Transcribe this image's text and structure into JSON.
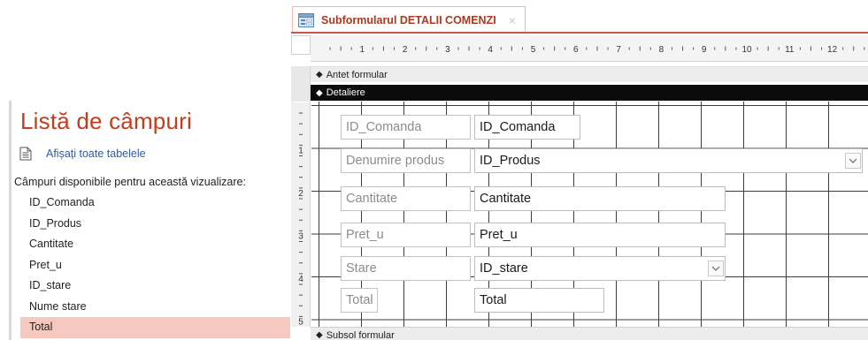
{
  "field_list": {
    "title": "Listă de câmpuri",
    "show_all_tables": "Afișați toate tabelele",
    "available_label": "Câmpuri disponibile pentru această vizualizare:",
    "fields": [
      "ID_Comanda",
      "ID_Produs",
      "Cantitate",
      "Pret_u",
      "ID_stare",
      "Nume stare",
      "Total"
    ],
    "selected_field": "Total"
  },
  "tab": {
    "title": "Subformularul DETALII COMENZI",
    "close_symbol": "×"
  },
  "ruler": {
    "h_numbers": [
      "1",
      "2",
      "3",
      "4",
      "5",
      "6",
      "7",
      "8",
      "9",
      "10",
      "11",
      "12"
    ],
    "v_numbers": [
      "1",
      "2",
      "3",
      "4",
      "5"
    ]
  },
  "sections": {
    "header": "Antet formular",
    "detail": "Detaliere",
    "footer": "Subsol formular"
  },
  "controls": [
    {
      "label": "ID_Comanda",
      "value": "ID_Comanda",
      "type": "text"
    },
    {
      "label": "Denumire produs",
      "value": "ID_Produs",
      "type": "combo"
    },
    {
      "label": "Cantitate",
      "value": "Cantitate",
      "type": "text"
    },
    {
      "label": "Pret_u",
      "value": "Pret_u",
      "type": "text"
    },
    {
      "label": "Stare",
      "value": "ID_stare",
      "type": "combo"
    },
    {
      "label": "Total",
      "value": "Total",
      "type": "text"
    }
  ],
  "colors": {
    "accent": "#c43b1d",
    "link": "#2a5da8",
    "selection": "#f6c9c0",
    "detail_bar": "#0b0b0b"
  },
  "icons": {
    "show_all": "document-list-icon",
    "tab": "form-icon",
    "section_marker": "section-marker-icon",
    "combo": "chevron-down-icon"
  }
}
